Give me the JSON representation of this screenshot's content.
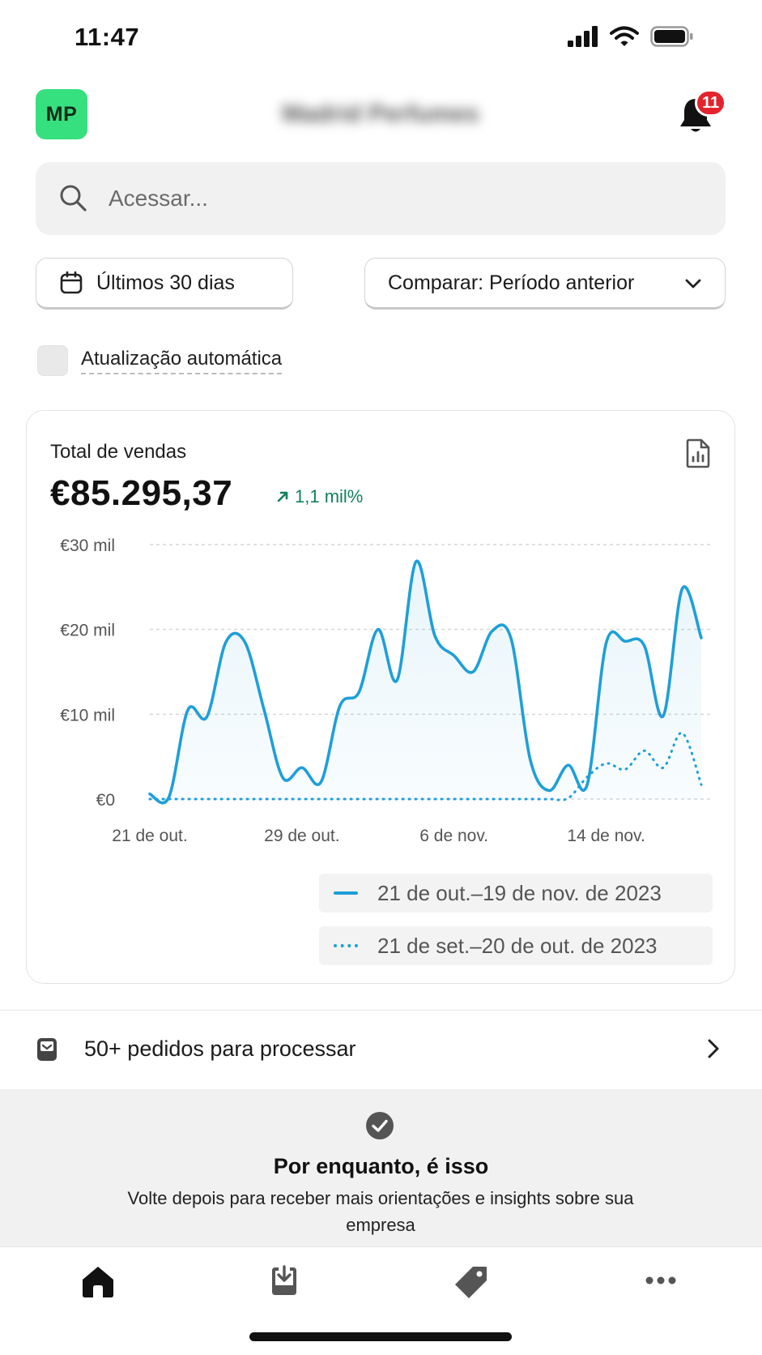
{
  "status_bar": {
    "time": "11:47"
  },
  "header": {
    "avatar_initials": "MP",
    "store_name": "Madrid Perfumes",
    "notification_count": "11"
  },
  "search": {
    "placeholder": "Acessar..."
  },
  "filters": {
    "date_range_label": "Últimos 30 dias",
    "compare_label": "Comparar: Período anterior"
  },
  "auto_update": {
    "label": "Atualização automática",
    "checked": false
  },
  "sales_card": {
    "title": "Total de vendas",
    "total": "€85.295,37",
    "change": "1,1 mil%",
    "trend": "up"
  },
  "chart_data": {
    "type": "line",
    "y_ticks": [
      "€30 mil",
      "€20 mil",
      "€10 mil",
      "€0"
    ],
    "x_ticks": [
      "21 de out.",
      "29 de out.",
      "6 de nov.",
      "14 de nov."
    ],
    "ylim": [
      0,
      30000
    ],
    "grid": true,
    "legend_placement": "bottom-right",
    "series": [
      {
        "name": "21 de out.–19 de nov. de 2023",
        "style": "solid",
        "color": "#1e9fd8",
        "values": [
          600,
          200,
          10500,
          9700,
          18500,
          18500,
          10600,
          2500,
          3700,
          2000,
          11000,
          12600,
          20000,
          14000,
          28000,
          19200,
          16900,
          15000,
          19800,
          18900,
          4700,
          1000,
          4000,
          1700,
          18400,
          18600,
          18100,
          9800,
          24800,
          19000
        ]
      },
      {
        "name": "21 de set.–20 de out. de 2023",
        "style": "dotted",
        "color": "#1e9fd8",
        "values": [
          0,
          0,
          0,
          0,
          0,
          0,
          0,
          0,
          0,
          0,
          0,
          0,
          0,
          0,
          0,
          0,
          0,
          0,
          0,
          0,
          0,
          0,
          100,
          2600,
          4200,
          3500,
          5700,
          3700,
          7800,
          1700
        ]
      }
    ]
  },
  "orders": {
    "label": "50+ pedidos para processar"
  },
  "empty_state": {
    "title": "Por enquanto, é isso",
    "text": "Volte depois para receber mais orientações e insights sobre sua empresa"
  },
  "tabbar": {
    "items": [
      "home-icon",
      "orders-icon",
      "products-icon",
      "more-icon"
    ]
  },
  "colors": {
    "accent": "#1e9fd8",
    "avatar": "#36e07f",
    "badge": "#e4232c",
    "trend_up": "#12805c"
  }
}
